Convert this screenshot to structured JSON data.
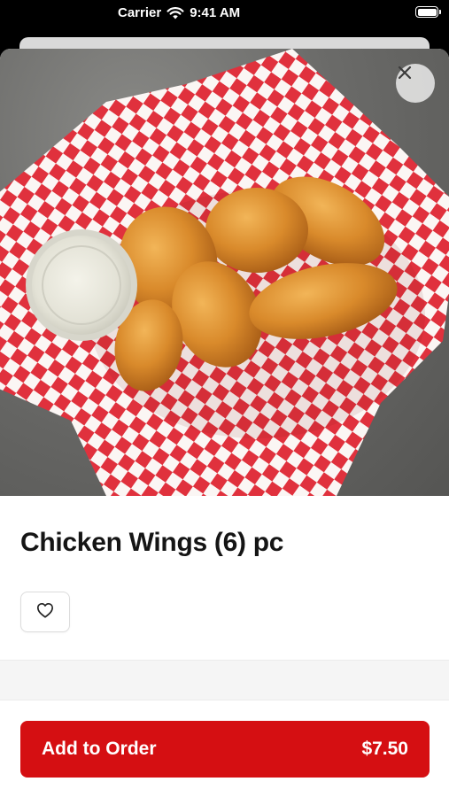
{
  "status_bar": {
    "carrier": "Carrier",
    "time": "9:41 AM",
    "battery_level": 1.0
  },
  "product": {
    "title": "Chicken Wings (6) pc",
    "image_alt": "fried chicken wings in a basket",
    "close_icon": "close-icon",
    "favorite_icon": "heart-outline-icon"
  },
  "order": {
    "button_label": "Add to Order",
    "price": "$7.50"
  },
  "colors": {
    "accent": "#d50f12",
    "text": "#151515"
  }
}
